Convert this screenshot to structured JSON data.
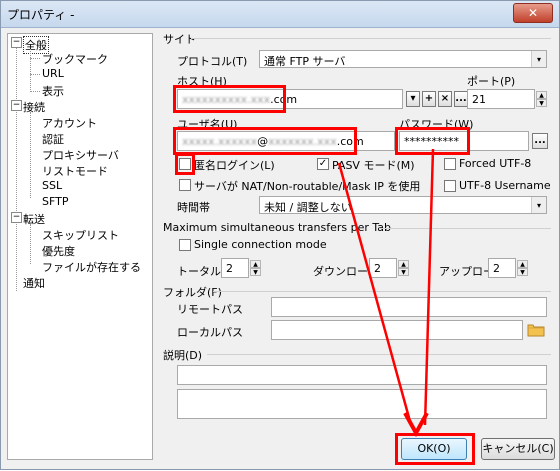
{
  "window": {
    "title": "プロパティ -",
    "close_icon": "✕"
  },
  "tree": {
    "items": [
      {
        "label": "全般"
      },
      {
        "label": "ブックマーク"
      },
      {
        "label": "URL"
      },
      {
        "label": "表示"
      },
      {
        "label": "接続"
      },
      {
        "label": "アカウント"
      },
      {
        "label": "認証"
      },
      {
        "label": "プロキシサーバ"
      },
      {
        "label": "リストモード"
      },
      {
        "label": "SSL"
      },
      {
        "label": "SFTP"
      },
      {
        "label": "転送"
      },
      {
        "label": "スキップリスト"
      },
      {
        "label": "優先度"
      },
      {
        "label": "ファイルが存在する"
      },
      {
        "label": "通知"
      }
    ],
    "expand_symbol": "−"
  },
  "site": {
    "group_label": "サイト",
    "protocol_label": "プロトコル(T)",
    "protocol_value": "通常 FTP サーバ",
    "host_label": "ホスト(H)",
    "host_value": ".com",
    "host_obscured": "xxxxxxxxxx.xxx",
    "port_label": "ポート(P)",
    "port_value": "21",
    "user_label": "ユーザ名(U)",
    "user_value_obscured": "xxxxx.xxxxxx",
    "user_value_at": "@",
    "user_value_obscured2": "xxxxxxx.xxx",
    "user_value_tail": ".com",
    "password_label": "パスワード(W)",
    "password_value": "**********",
    "anonymous_label": "匿名ログイン(L)",
    "pasv_label": "PASV モード(M)",
    "forced_utf8_label": "Forced UTF-8",
    "nat_label": "サーバが NAT/Non-routable/Mask IP を使用",
    "utf8_username_label": "UTF-8 Username",
    "timezone_label": "時間帯",
    "timezone_value": "未知 / 調整しない",
    "pasv_checked": "✓"
  },
  "transfers": {
    "group_label": "Maximum simultaneous transfers per Tab",
    "single_connection_label": "Single connection mode",
    "total_label": "トータル",
    "total_value": "2",
    "download_label": "ダウンロード",
    "download_value": "2",
    "upload_label": "アップロード",
    "upload_value": "2"
  },
  "folder": {
    "group_label": "フォルダ(F)",
    "remote_label": "リモートパス",
    "local_label": "ローカルパス"
  },
  "description": {
    "group_label": "説明(D)"
  },
  "buttons": {
    "ok": "OK(O)",
    "cancel": "キャンセル(C)"
  },
  "host_buttons": {
    "dropdown": "▾",
    "add": "+",
    "delete": "×",
    "more": "..."
  },
  "password_more": "...",
  "spin_symbols": {
    "up": "▲",
    "down": "▼"
  },
  "folder_icon": "folder-icon"
}
